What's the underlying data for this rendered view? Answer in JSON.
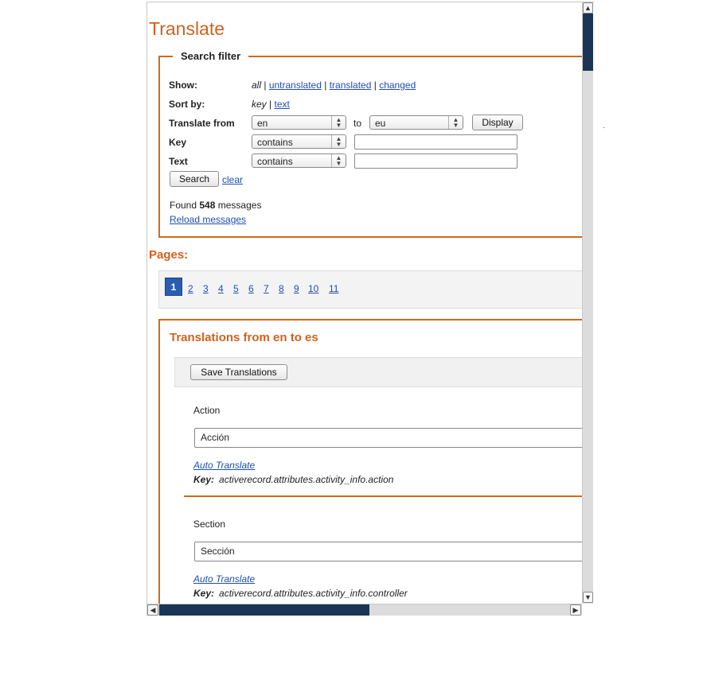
{
  "page": {
    "title": "Translate"
  },
  "filter": {
    "legend": "Search filter",
    "show": {
      "label": "Show:",
      "current": "all",
      "sep": "|",
      "links": [
        "untranslated",
        "translated",
        "changed"
      ]
    },
    "sort": {
      "label": "Sort by:",
      "current": "key",
      "sep": "|",
      "link": "text"
    },
    "translate_from": {
      "label": "Translate from",
      "from": "en",
      "to_label": "to",
      "to": "eu",
      "display_button": "Display"
    },
    "key": {
      "label": "Key",
      "mode": "contains",
      "value": ""
    },
    "text": {
      "label": "Text",
      "mode": "contains",
      "value": ""
    },
    "search_button": "Search",
    "clear_link": "clear",
    "found": {
      "prefix": "Found",
      "count": "548",
      "suffix": "messages"
    },
    "reload_link": "Reload messages"
  },
  "pages": {
    "title": "Pages:",
    "current": "1",
    "items": [
      "1",
      "2",
      "3",
      "4",
      "5",
      "6",
      "7",
      "8",
      "9",
      "10",
      "11"
    ]
  },
  "translations": {
    "title": "Translations from en to es",
    "save_button": "Save Translations",
    "items": [
      {
        "label": "Action",
        "value": "Acción",
        "auto": "Auto Translate",
        "key_label": "Key:",
        "key": "activerecord.attributes.activity_info.action"
      },
      {
        "label": "Section",
        "value": "Sección",
        "auto": "Auto Translate",
        "key_label": "Key:",
        "key": "activerecord.attributes.activity_info.controller"
      }
    ]
  },
  "scrollbars": {
    "vertical_position": 0.05,
    "horizontal_position": 0.0
  },
  "colors": {
    "accent": "#d2601e",
    "link": "#1f4fb0",
    "scroll_thumb": "#1c3556",
    "active_page": "#2a5db0"
  },
  "icons": {
    "select_arrow": "updown-chevron-icon",
    "scroll_up": "up-arrow-icon",
    "scroll_down": "down-arrow-icon",
    "scroll_left": "left-arrow-icon",
    "scroll_right": "right-arrow-icon"
  }
}
